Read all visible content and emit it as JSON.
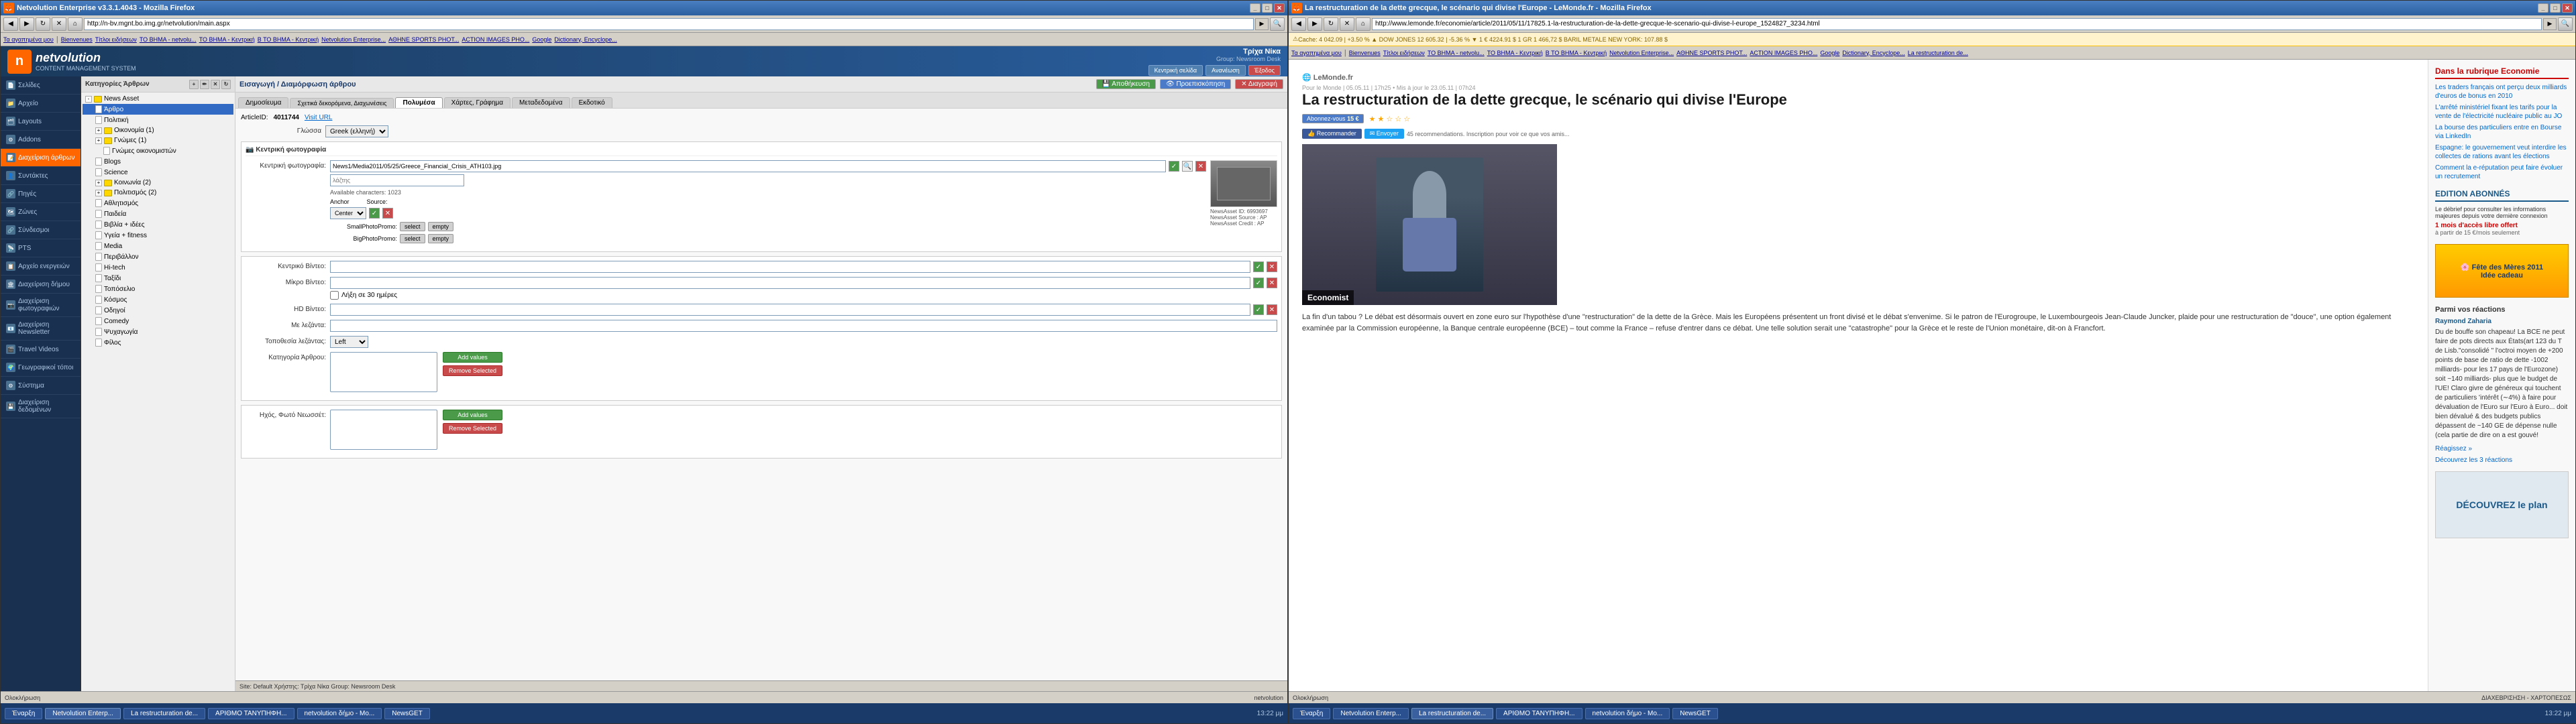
{
  "left_window": {
    "title": "Netvolution Enterprise v3.3.1.4043 - Mozilla Firefox",
    "address": "http://n-bv.mgnt.bo.img.gr/netvolution/main.aspx",
    "bookmarks": [
      "Τα αγαπημένα μου",
      "Bienvenues",
      "Τίτλοι ειδήσεων",
      "ΤΟ ΒΗΜΑ - netvolu...",
      "ΤΟ ΒΗΜΑ - Κεντρική",
      "Β ΤΟ ΒΗΜΑ - Κεντρική",
      "Netvolution Enterprise...",
      "ΑΘΗΝΕ SPORTS PHOT...",
      "ACTION IMAGES PHO...",
      "Google",
      "Dictionary, Encyclope..."
    ],
    "app": {
      "logo": "n",
      "brand": "netvolution",
      "cms_label": "CONTENT MANAGEMENT SYSTEM",
      "user_name": "Τρίχα Νίκα",
      "user_group": "Newsroom Desk",
      "buttons": {
        "email": "Κεντρική σελίδα",
        "notify": "Ανανέωση",
        "exit": "Έξοδος"
      }
    },
    "sidebar": {
      "items": [
        {
          "label": "Σελίδες",
          "icon": "pages"
        },
        {
          "label": "Αρχείο",
          "icon": "archive"
        },
        {
          "label": "Layouts",
          "icon": "layout"
        },
        {
          "label": "Addons",
          "icon": "addons"
        },
        {
          "label": "Διαχείριση άρθρων",
          "icon": "articles"
        },
        {
          "label": "Συντάκτες",
          "icon": "authors"
        },
        {
          "label": "Πηγές",
          "icon": "sources"
        },
        {
          "label": "Ζώνες",
          "icon": "zones"
        },
        {
          "label": "Σύνδεσμοι",
          "icon": "links"
        },
        {
          "label": "ΡΤS",
          "icon": "rts"
        },
        {
          "label": "Αρχείο ενεργειών",
          "icon": "log"
        },
        {
          "label": "Διαχείριση δήμου",
          "icon": "demo"
        },
        {
          "label": "Διαχείριση φωτογραφιών",
          "icon": "photos"
        },
        {
          "label": "Διαχείριση Newsletter",
          "icon": "newsletter"
        },
        {
          "label": "Travel Videos",
          "icon": "videos"
        },
        {
          "label": "Γεωγραφικοί τόποι",
          "icon": "geo"
        },
        {
          "label": "Σύστημα",
          "icon": "system"
        },
        {
          "label": "Διαχείριση δεδομένων",
          "icon": "data"
        }
      ]
    },
    "tree": {
      "header": "Κατηγορίες Άρθρων",
      "items": [
        {
          "label": "News Asset",
          "level": 1,
          "expanded": true
        },
        {
          "label": "Άρθρο",
          "level": 2,
          "selected": true
        },
        {
          "label": "Πολιτική",
          "level": 2
        },
        {
          "label": "Οικονομία (1)",
          "level": 2
        },
        {
          "label": "Γνώμες (1)",
          "level": 2
        },
        {
          "label": "Γνώμες οικονομιστών",
          "level": 3
        },
        {
          "label": "Blogs",
          "level": 2
        },
        {
          "label": "Science",
          "level": 2
        },
        {
          "label": "Κοινωνία (2)",
          "level": 2
        },
        {
          "label": "Πολιτισμός (2)",
          "level": 2
        },
        {
          "label": "Αθλητισμός",
          "level": 2
        },
        {
          "label": "Παιδεία",
          "level": 2
        },
        {
          "label": "Βιβλία + ιδέες",
          "level": 2
        },
        {
          "label": "Υγεία + fitness",
          "level": 2
        },
        {
          "label": "Media",
          "level": 2
        },
        {
          "label": "Περιβάλλον",
          "level": 2
        },
        {
          "label": "Hi-tech",
          "level": 2
        },
        {
          "label": "Ταξίδι",
          "level": 2
        },
        {
          "label": "Τοπόσελιο",
          "level": 2
        },
        {
          "label": "Κόσμος",
          "level": 2
        },
        {
          "label": "Οδηγοί",
          "level": 2
        },
        {
          "label": "Comedy",
          "level": 2
        },
        {
          "label": "Ψυχαγωγία",
          "level": 2
        },
        {
          "label": "Φίλος",
          "level": 2
        }
      ]
    },
    "editor": {
      "article_id": "4011744",
      "visit_url_label": "Visit URL",
      "language_label": "Γλώσσα",
      "language_value": "Greek (ελληνή) ▼",
      "tabs": [
        "Δημοσίευμα",
        "Σχετικά δεκορόμενα, Διαχωνέσεις",
        "Πολυμέσα",
        "Χάρτες, Γράφημα",
        "Μεταδεδομένα",
        "Εκδοτικό"
      ],
      "active_tab": "Πολυμέσα",
      "photo_section": {
        "label": "Κεντρική φωτογραφία:",
        "filename": "News1/Media2011/05/25/Greece_Financial_Crisis_ATH103.jpg",
        "lazy_label": "λάζτης",
        "available_chars": "1023",
        "anchor_label": "Anchor",
        "anchor_value": "Center",
        "source_label": "Source:",
        "small_photo_label": "SmallPhotoPromo:",
        "big_photo_label": "BigPhotoPromo:",
        "select_btn": "select",
        "empty_btn": "empty",
        "news_asset_id": "6993697",
        "news_asset_source": "AP",
        "news_asset_credit": "AP"
      },
      "video_section": {
        "label": "Κεντρικό Βίντεο:",
        "small_label": "Μίκρο Βίντεο:",
        "checkbox_30": "Λήξη σε 30 ημέρες",
        "hd_label": "HD Βίντεο:",
        "caption_label": "Με λεζάντα:",
        "position_label": "Τοποθεσία λεζάντας:",
        "position_value": "Left",
        "keyword_label": "Κατηγορία Άρθρου:",
        "listbox_values": [],
        "add_values_btn": "Add values",
        "remove_selected_btn": "Remove Selected"
      },
      "photo2_section": {
        "label": "Ηχός, Φωτό Νεωσσέτ:",
        "add_values_btn": "Add values",
        "remove_selected_btn": "Remove Selected"
      },
      "bottom_status": "Site: Default  Χρήστης: Τρίχα Νίκα  Group: Newsroom Desk"
    },
    "toolbar_buttons": {
      "save": "Κεντρική σελίδα",
      "refresh": "Ανανέωση",
      "exit": "Έξοδος"
    },
    "status_bar": {
      "items": [
        "Ολοκλήρωση",
        "netvolution"
      ]
    },
    "taskbar": {
      "items": [
        "Έναρξη",
        "Netvolution Enterp...",
        "La restructuration de...",
        "ΑΡΙΘΜΟ ΤΑΝΥΠΗΦΗ...",
        "netvolution δήμο - Mo...",
        "NewsGET"
      ],
      "time": "13:22 μμ"
    }
  },
  "right_window": {
    "title": "La restructuration de la dette grecque, le scénario qui divise l'Europe - LeMonde.fr - Mozilla Firefox",
    "address": "http://www.lemonde.fr/economie/article/2011/05/11/17825.1-la-restructuration-de-la-dette-grecque-le-scenario-qui-divise-l-europe_1524827_3234.html",
    "security_warning": "Cache: 4 042.09 | +3.50 % ▲    DOW JONES 12 605.32 | -5.36 % ▼    1 € 4224.91 $    1 GR 1 466,72 $    BARIL METALE NEW YORK: 107.88 $",
    "bookmarks": [
      "Τα αγαπημένα μου",
      "Bienvenues",
      "Τίτλοι ειδήσεων",
      "ΤΟ ΒΗΜΑ - netvolu...",
      "ΤΟ ΒΗΜΑ - Κεντρική",
      "Β ΤΟ ΒΗΜΑ - Κεντρική",
      "Netvolution Enterprise...",
      "ΑΘΗΝΕ SPORTS PHOT...",
      "ACTION IMAGES PHO...",
      "Google",
      "Dictionary, Encyclope...",
      "La restructuration de..."
    ],
    "article": {
      "source": "LeMonde.fr",
      "source_section": "Economie",
      "date_line": "Pour le Monde | 05.05.11 | 17h25 • Mis à jour le 23.05.11 | 07h24",
      "title": "La restructuration de la dette grecque, le scénario qui divise l'Europe",
      "subscribe_price": "15 €",
      "subscribe_text": "Abonnez-vous",
      "social_facebook": "Recommander",
      "social_twitter": "Envoyer",
      "social_count": "45 recommendations. Inscription pour voir ce que vos amis...",
      "image_label": "Economist",
      "image_alt": "George Papandreou at podium",
      "body_text": "La fin d'un tabou ? Le débat est désormais ouvert en zone euro sur l'hypothèse d'une \"restructuration\" de la dette de la Grèce. Mais les Européens présentent un front divisé et le débat s'envenime. Si le patron de l'Eurogroupe, le Luxembourgeois Jean-Claude Juncker, plaide pour une restructuration de \"douce\", une option également examinée par la Commission européenne, la Banque centrale européenne (BCE) – tout comme la France – refuse d'entrer dans ce débat. Une telle solution serait une \"catastrophe\" pour la Grèce et le reste de l'Union monétaire, dit-on à Francfort.",
      "sidebar_section_title": "Dans la rubrique Economie",
      "sidebar_links": [
        "Les traders français ont perçu deux milliards d'euros de bonus en 2010",
        "L'arrêté ministériel fixant les tarifs pour la vente de l'électricité nucléaire public au JO",
        "La bourse des particuliers entre en Bourse via LinkedIn",
        "Espagne: le gouvernement veut interdire les collectes de rations avant les élections",
        "Comment la e-réputation peut faire évoluer un recrutement"
      ],
      "edition_title": "EDITION ABONNÉS",
      "edition_text": "Le débrief pour consulter les informations majeures depuis votre dernière connexion",
      "edition_price": "1 mois d'accès libre offert",
      "edition_sub": "à partir de 15 €/mois seulement",
      "reactions_title": "Parmi vos réactions",
      "reaction_author": "Raymond Zaharia",
      "reaction_text": "Du de bouffe son chapeau! La BCE ne peut faire de pots directs aux États(art 123 du T de Lisb.\"consolidé \" l'octroi moyen de +200 points de base de ratio de dette -1002 milliards- pour les 17 pays de l'Eurozone) soit ~140 milliards- plus que le budget de l'UE! Claro givre de généreux qui touchent de particuliers 'intérêt (∼4%) à faire pour dévaluation de l'Euro sur l'Euro à Euro... doit bien dévalué & des budgets publics dépassent de ~140 GE de dépense nulle (cela partie de dire on a est gouvé!",
      "ad_title": "DÉCOUVREZ le plan"
    },
    "taskbar": {
      "items": [
        "Έναρξη",
        "Netvolution Enterp...",
        "La restructuration de...",
        "ΑΡΙΘΜΟ ΤΑΝΥΠΗΦΗ...",
        "netvolution δήμο - Mo...",
        "NewsGET"
      ],
      "time": "13:22 μμ"
    }
  }
}
